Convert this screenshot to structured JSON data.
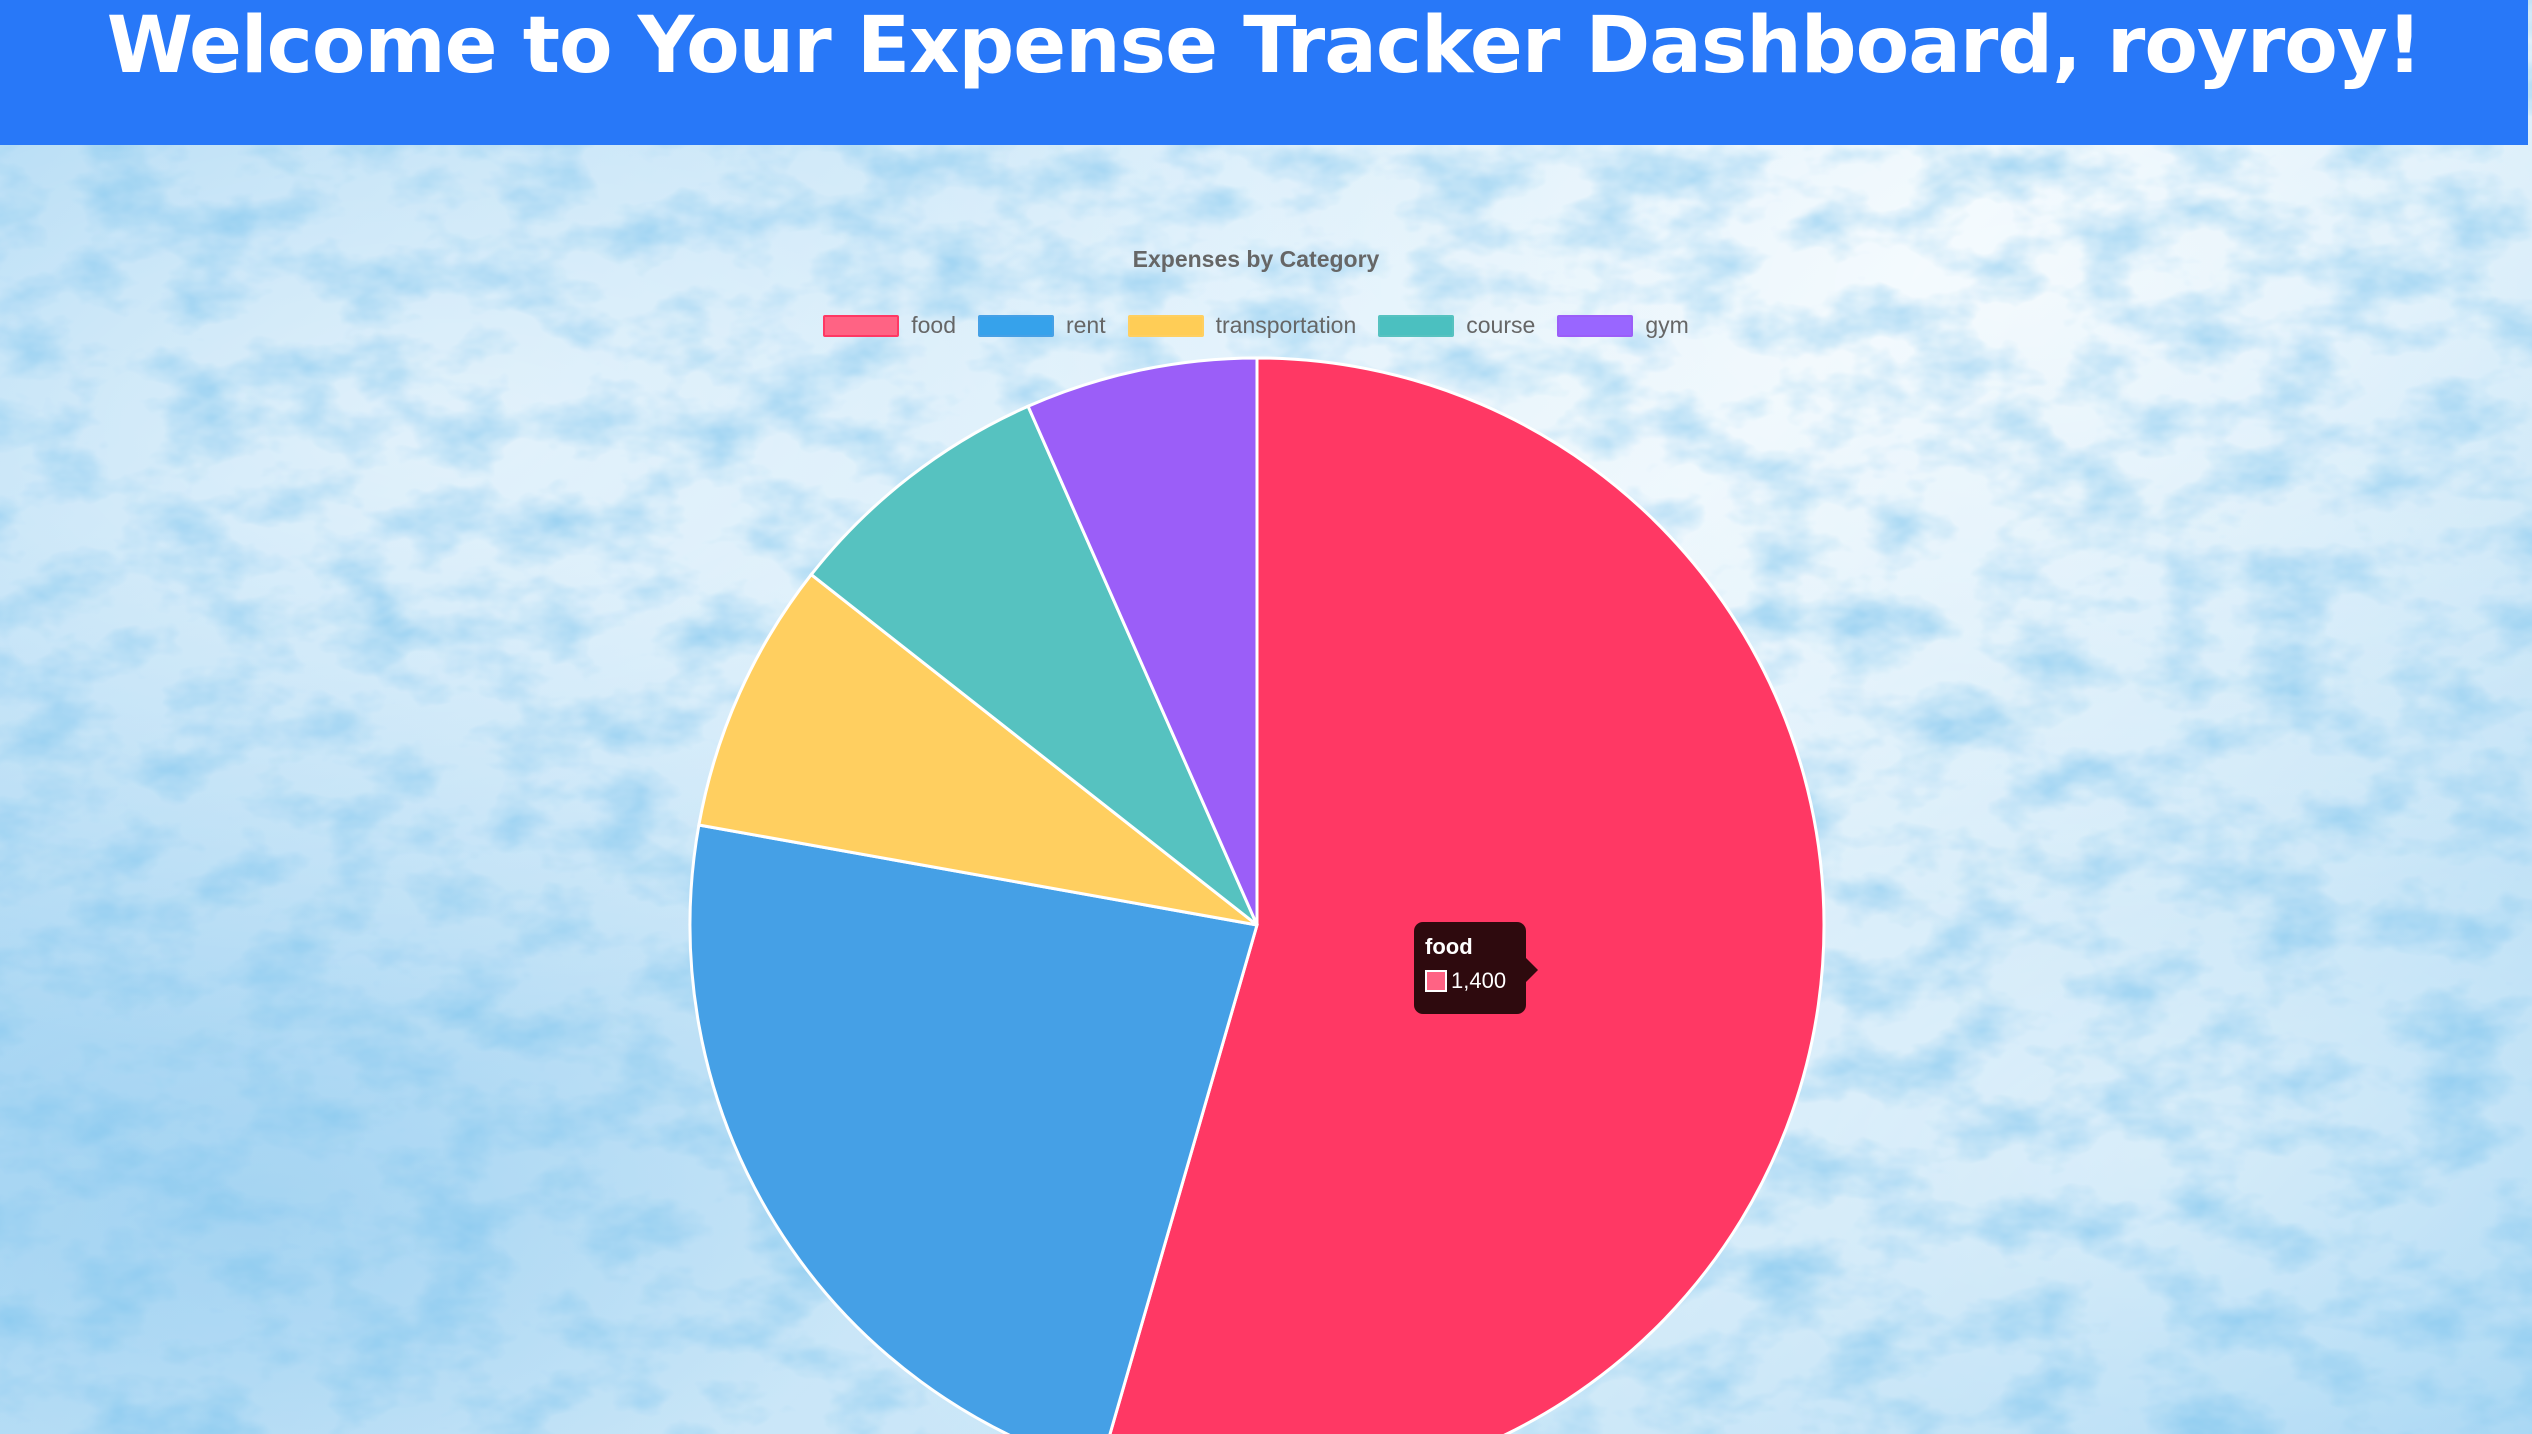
{
  "header": {
    "title": "Welcome to Your Expense Tracker Dashboard, royroy!"
  },
  "chart_data": {
    "type": "pie",
    "title": "Expenses by Category",
    "legend_position": "top",
    "categories": [
      "food",
      "rent",
      "transportation",
      "course",
      "gym"
    ],
    "values": [
      1400,
      600,
      200,
      200,
      170
    ],
    "colors": [
      "#ff3864",
      "#45a0e6",
      "#ffcf60",
      "#56c2c0",
      "#9b5ef8"
    ],
    "legend_colors": [
      "#ff6384",
      "#36a2eb",
      "#ffcd56",
      "#4bc0c0",
      "#9966ff"
    ]
  },
  "tooltip": {
    "title": "food",
    "value": "1,400",
    "color": "#ff6384"
  }
}
